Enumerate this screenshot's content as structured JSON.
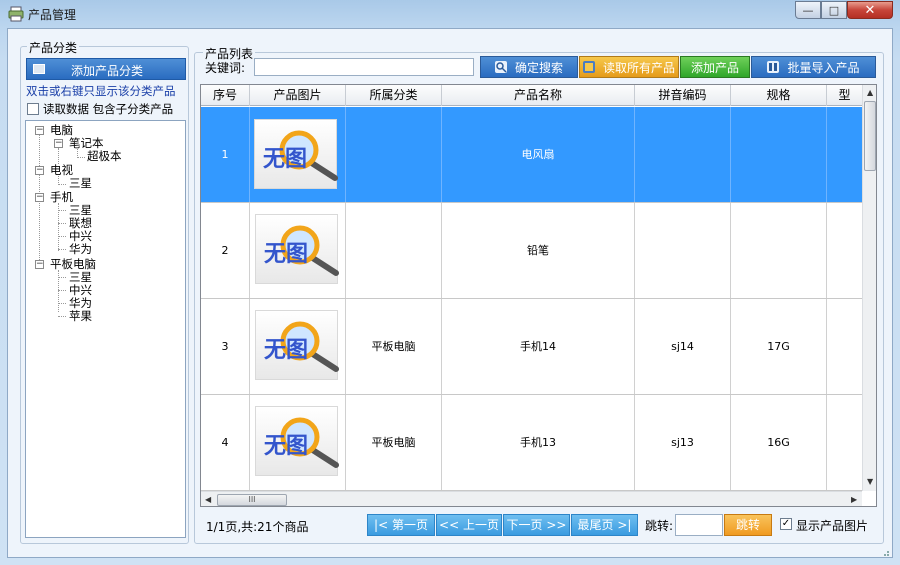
{
  "window": {
    "title": "产品管理",
    "min": "—",
    "max": "□",
    "close": "✕"
  },
  "left": {
    "group_label": "产品分类",
    "add_button": "添加产品分类",
    "hint": "双击或右键只显示该分类产品",
    "read_label": "读取数据  包含子分类产品",
    "read_checked": false,
    "tree": [
      {
        "label": "电脑",
        "children": [
          {
            "label": "笔记本",
            "children": [
              {
                "label": "超极本"
              }
            ]
          }
        ]
      },
      {
        "label": "电视",
        "children": [
          {
            "label": "三星"
          }
        ]
      },
      {
        "label": "手机",
        "children": [
          {
            "label": "三星"
          },
          {
            "label": "联想"
          },
          {
            "label": "中兴"
          },
          {
            "label": "华为"
          }
        ]
      },
      {
        "label": "平板电脑",
        "children": [
          {
            "label": "三星"
          },
          {
            "label": "中兴"
          },
          {
            "label": "华为"
          },
          {
            "label": "苹果"
          }
        ]
      }
    ]
  },
  "right": {
    "group_label": "产品列表",
    "keyword_label": "关键词:",
    "keyword_value": "",
    "buttons": {
      "search": "确定搜索",
      "read_all": "读取所有产品",
      "add": "添加产品",
      "import": "批量导入产品"
    },
    "columns": [
      "序号",
      "产品图片",
      "所属分类",
      "产品名称",
      "拼音编码",
      "规格",
      "型"
    ],
    "no_image_text": "无图",
    "rows": [
      {
        "no": "1",
        "category": "",
        "name": "电风扇",
        "pinyin": "",
        "spec": "",
        "selected": true
      },
      {
        "no": "2",
        "category": "",
        "name": "铅笔",
        "pinyin": "",
        "spec": "",
        "selected": false
      },
      {
        "no": "3",
        "category": "平板电脑",
        "name": "手机14",
        "pinyin": "sj14",
        "spec": "17G",
        "selected": false
      },
      {
        "no": "4",
        "category": "平板电脑",
        "name": "手机13",
        "pinyin": "sj13",
        "spec": "16G",
        "selected": false
      }
    ],
    "hscroll_grip": "III"
  },
  "footer": {
    "page_info": "1/1页,共:21个商品",
    "first": "|< 第一页",
    "prev": "<< 上一页",
    "next": "下一页 >>",
    "last": "最尾页 >|",
    "jump_label": "跳转:",
    "jump_value": "",
    "jump_button": "跳转",
    "show_images_label": "显示产品图片",
    "show_images_checked": true
  },
  "colors": {
    "selection": "#3399ff",
    "accent_blue": "#2a6cc0",
    "accent_orange": "#e59b19",
    "accent_green": "#2fa62a",
    "link_blue": "#1a3fa8"
  }
}
